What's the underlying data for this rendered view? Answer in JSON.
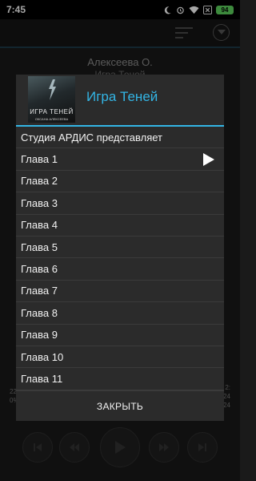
{
  "status": {
    "time": "7:45",
    "battery": "94",
    "icons": [
      "moon-icon",
      "alarm-icon",
      "wifi-icon",
      "close-box-icon",
      "battery-icon"
    ]
  },
  "toolbar": {
    "icons": [
      "sort-menu-icon",
      "dropdown-circle-icon"
    ]
  },
  "player": {
    "author": "Алексеева О.",
    "title": "Игра Теней",
    "stats_left": [
      "22",
      "0%"
    ],
    "stats_right": [
      "2:",
      "24",
      "24"
    ],
    "controls": [
      "skip-previous-icon",
      "rewind-icon",
      "play-icon",
      "fast-forward-icon",
      "skip-next-icon"
    ]
  },
  "dialog": {
    "title": "Игра Теней",
    "cover": {
      "title": "ИГРА ТЕНЕЙ",
      "author": "ОКСАНА АЛЕКСЕЕВА"
    },
    "items": [
      "Студия АРДИС представляет",
      "Глава 1",
      "Глава 2",
      "Глава 3",
      "Глава 4",
      "Глава 5",
      "Глава 6",
      "Глава 7",
      "Глава 8",
      "Глава 9",
      "Глава 10",
      "Глава 11"
    ],
    "playing_index": 1,
    "close_label": "ЗАКРЫТЬ"
  },
  "colors": {
    "accent": "#33b5e5",
    "battery": "#5fd45f",
    "dialog_bg": "#2b2b2b"
  }
}
